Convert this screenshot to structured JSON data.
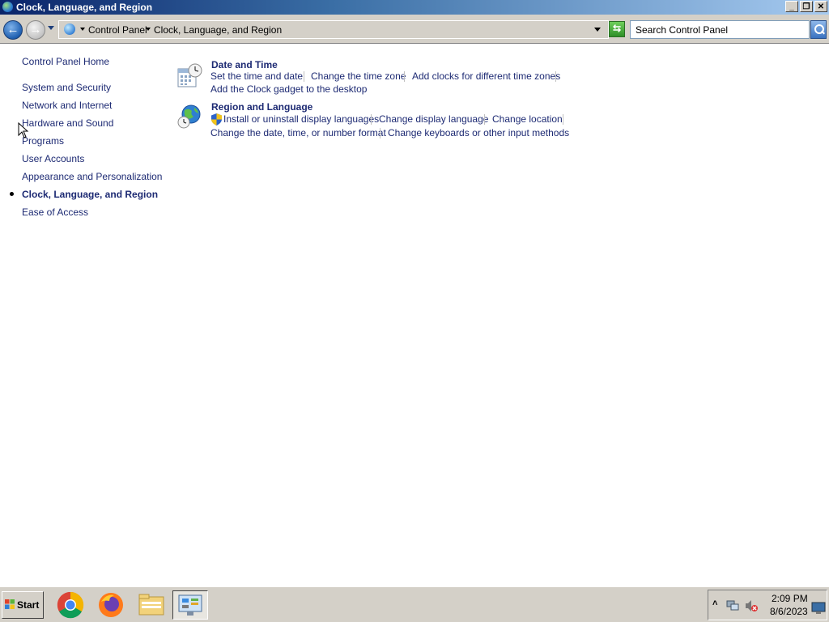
{
  "window": {
    "title": "Clock, Language, and Region",
    "controls": [
      "_",
      "❐",
      "✕"
    ]
  },
  "addressbar": {
    "breadcrumb": [
      "Control Panel",
      "Clock, Language, and Region"
    ],
    "search_placeholder": "Search Control Panel"
  },
  "sidebar": {
    "home": "Control Panel Home",
    "items": [
      {
        "label": "System and Security"
      },
      {
        "label": "Network and Internet"
      },
      {
        "label": "Hardware and Sound"
      },
      {
        "label": "Programs"
      },
      {
        "label": "User Accounts"
      },
      {
        "label": "Appearance and Personalization"
      },
      {
        "label": "Clock, Language, and Region",
        "current": true
      },
      {
        "label": "Ease of Access"
      }
    ]
  },
  "categories": [
    {
      "title": "Date and Time",
      "icon": "clock-calendar-icon",
      "tasks": [
        "Set the time and date",
        "Change the time zone",
        "Add clocks for different time zones",
        "Add the Clock gadget to the desktop"
      ]
    },
    {
      "title": "Region and Language",
      "icon": "globe-clock-icon",
      "tasks": [
        "Install or uninstall display languages",
        "Change display language",
        "Change location",
        "Change the date, time, or number format",
        "Change keyboards or other input methods"
      ]
    }
  ],
  "taskbar": {
    "start_label": "Start",
    "apps": [
      "chrome-icon",
      "firefox-icon",
      "file-explorer-icon",
      "control-panel-icon"
    ],
    "clock": {
      "time": "2:09 PM",
      "date": "8/6/2023"
    }
  }
}
